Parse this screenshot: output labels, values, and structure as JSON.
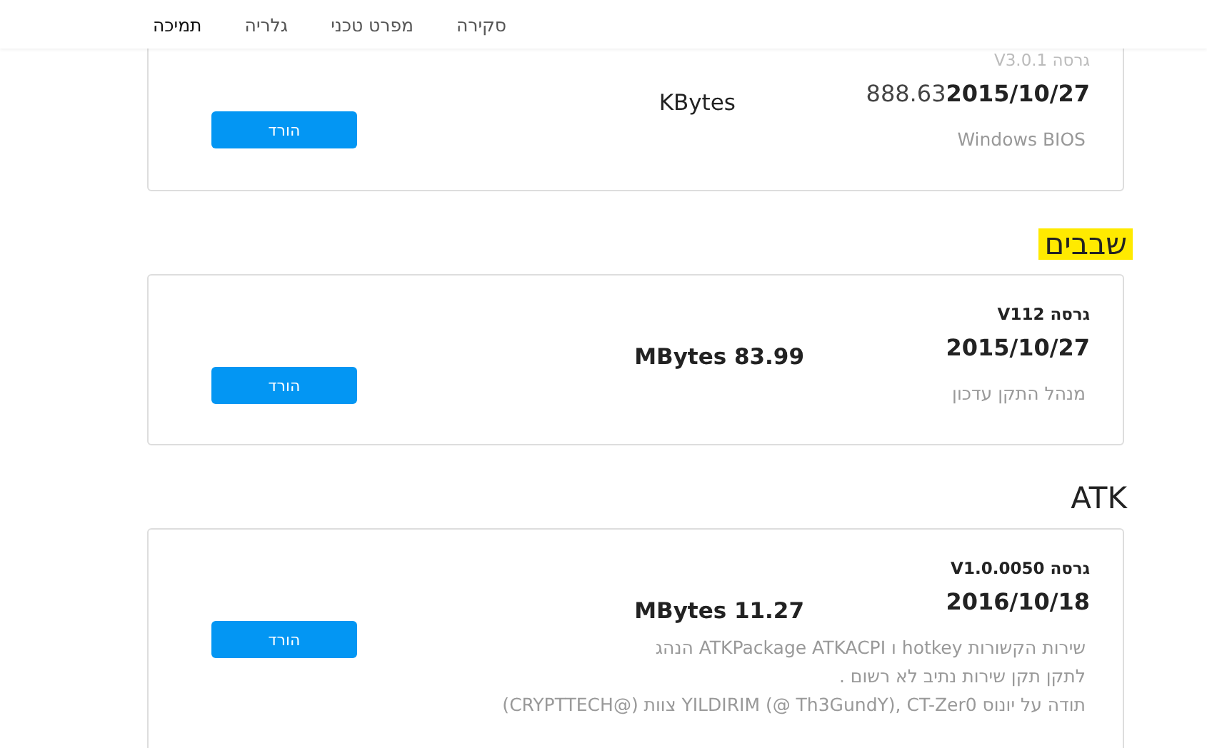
{
  "nav": {
    "tabs": [
      {
        "label": "סקירה",
        "selected": false
      },
      {
        "label": "מפרט טכני",
        "selected": false
      },
      {
        "label": "גלריה",
        "selected": false
      },
      {
        "label": "תמיכה",
        "selected": true
      }
    ]
  },
  "sections": [
    {
      "items": [
        {
          "version": "גרסה V3.0.1",
          "date": "2015/10/27",
          "date_trail": "888.63",
          "size": "KBytes",
          "description": [
            "Windows BIOS"
          ],
          "button": "הורד"
        }
      ]
    },
    {
      "heading": "שבבים",
      "highlighted": true,
      "items": [
        {
          "version": "גרסה V112",
          "date": "2015/10/27",
          "size": "MBytes 83.99",
          "description": [
            "מנהל התקן עדכון"
          ],
          "button": "הורד"
        }
      ]
    },
    {
      "heading": "ATK",
      "highlighted": false,
      "items": [
        {
          "version": "גרסה V1.0.0050",
          "date": "2016/10/18",
          "size": "MBytes 11.27",
          "description": [
            "שירות הקשורות hotkey ו ATKPackage ATKACPI הנהג",
            "לתקן תקן שירות נתיב לא רשום .",
            "תודה על יונוס YILDIRIM (@ Th3GundY), CT-Zer0 צוות (@CRYPTTECH)"
          ],
          "button": "הורד"
        }
      ]
    }
  ]
}
